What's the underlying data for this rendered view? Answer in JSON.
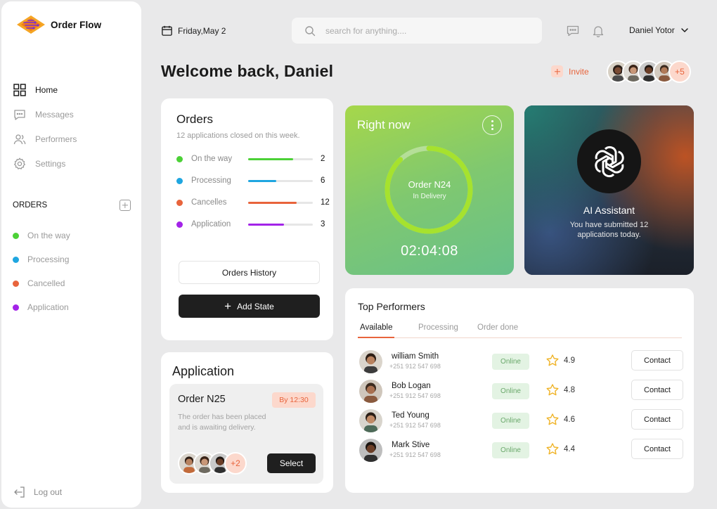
{
  "brand": {
    "name": "Order Flow",
    "accent": "#e8643c"
  },
  "sidebar": {
    "nav": [
      {
        "label": "Home",
        "icon": "grid-icon",
        "active": true
      },
      {
        "label": "Messages",
        "icon": "chat-icon"
      },
      {
        "label": "Performers",
        "icon": "users-icon"
      },
      {
        "label": "Settings",
        "icon": "gear-icon"
      }
    ],
    "orders_heading": "ORDERS",
    "orders": [
      {
        "label": "On the way",
        "color": "#4cd137"
      },
      {
        "label": "Processing",
        "color": "#1fa6e0"
      },
      {
        "label": "Cancelled",
        "color": "#e8643c"
      },
      {
        "label": "Application",
        "color": "#a323e8"
      }
    ],
    "logout": "Log out"
  },
  "topbar": {
    "date": "Friday,May 2",
    "search_placeholder": "search for anything....",
    "user_name": "Daniel Yotor"
  },
  "welcome": "Welcome back, Daniel",
  "invite": {
    "label": "Invite",
    "more_count": "+5"
  },
  "orders_card": {
    "title": "Orders",
    "subtitle": "12 applications closed on this week.",
    "stats": [
      {
        "label": "On the way",
        "value": "2",
        "fill": 0.7,
        "color": "#4cd137"
      },
      {
        "label": "Processing",
        "value": "6",
        "fill": 0.43,
        "color": "#1fa6e0"
      },
      {
        "label": "Cancelles",
        "value": "12",
        "fill": 0.75,
        "color": "#e8643c"
      },
      {
        "label": "Application",
        "value": "3",
        "fill": 0.55,
        "color": "#a323e8"
      }
    ],
    "history_button": "Orders History",
    "add_button": "Add State"
  },
  "application_card": {
    "title": "Application",
    "order_name": "Order N25",
    "badge": "By 12:30",
    "description": "The order has been placed and is awaiting delivery.",
    "more_count": "+2",
    "select_button": "Select"
  },
  "right_now": {
    "title": "Right now",
    "order_name": "Order N24",
    "status": "In Delivery",
    "timer": "02:04:08",
    "progress": 0.88
  },
  "ai_assistant": {
    "title": "AI Assistant",
    "description": "You have submitted 12 applications today."
  },
  "performers": {
    "title": "Top Performers",
    "tabs": [
      "Available",
      "Processing",
      "Order done"
    ],
    "rows": [
      {
        "name": "william Smith",
        "phone": "+251 912 547 698",
        "status": "Online",
        "rating": "4.9",
        "action": "Contact"
      },
      {
        "name": "Bob Logan",
        "phone": "+251 912 547 698",
        "status": "Online",
        "rating": "4.8",
        "action": "Contact"
      },
      {
        "name": "Ted Young",
        "phone": "+251 912 547 698",
        "status": "Online",
        "rating": "4.6",
        "action": "Contact"
      },
      {
        "name": "Mark Stive",
        "phone": "+251 912 547 698",
        "status": "Online",
        "rating": "4.4",
        "action": "Contact"
      }
    ]
  }
}
